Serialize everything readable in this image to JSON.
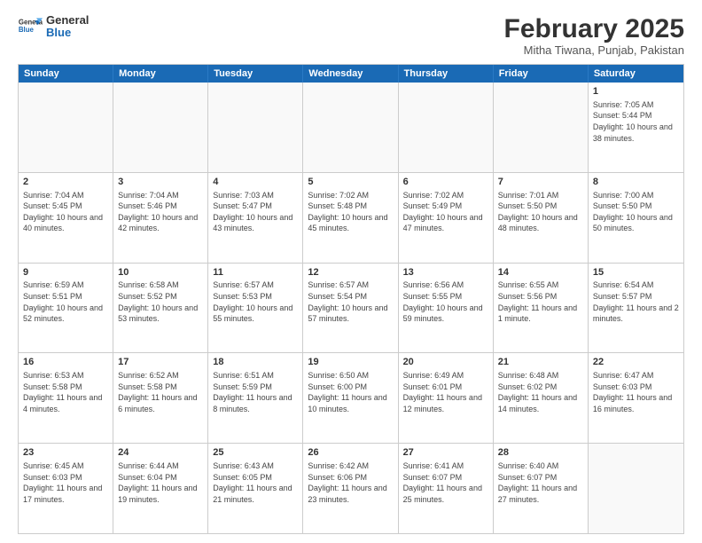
{
  "logo": {
    "line1": "General",
    "line2": "Blue"
  },
  "title": {
    "month_year": "February 2025",
    "location": "Mitha Tiwana, Punjab, Pakistan"
  },
  "header_days": [
    "Sunday",
    "Monday",
    "Tuesday",
    "Wednesday",
    "Thursday",
    "Friday",
    "Saturday"
  ],
  "weeks": [
    [
      {
        "day": "",
        "text": ""
      },
      {
        "day": "",
        "text": ""
      },
      {
        "day": "",
        "text": ""
      },
      {
        "day": "",
        "text": ""
      },
      {
        "day": "",
        "text": ""
      },
      {
        "day": "",
        "text": ""
      },
      {
        "day": "1",
        "text": "Sunrise: 7:05 AM\nSunset: 5:44 PM\nDaylight: 10 hours and 38 minutes."
      }
    ],
    [
      {
        "day": "2",
        "text": "Sunrise: 7:04 AM\nSunset: 5:45 PM\nDaylight: 10 hours and 40 minutes."
      },
      {
        "day": "3",
        "text": "Sunrise: 7:04 AM\nSunset: 5:46 PM\nDaylight: 10 hours and 42 minutes."
      },
      {
        "day": "4",
        "text": "Sunrise: 7:03 AM\nSunset: 5:47 PM\nDaylight: 10 hours and 43 minutes."
      },
      {
        "day": "5",
        "text": "Sunrise: 7:02 AM\nSunset: 5:48 PM\nDaylight: 10 hours and 45 minutes."
      },
      {
        "day": "6",
        "text": "Sunrise: 7:02 AM\nSunset: 5:49 PM\nDaylight: 10 hours and 47 minutes."
      },
      {
        "day": "7",
        "text": "Sunrise: 7:01 AM\nSunset: 5:50 PM\nDaylight: 10 hours and 48 minutes."
      },
      {
        "day": "8",
        "text": "Sunrise: 7:00 AM\nSunset: 5:50 PM\nDaylight: 10 hours and 50 minutes."
      }
    ],
    [
      {
        "day": "9",
        "text": "Sunrise: 6:59 AM\nSunset: 5:51 PM\nDaylight: 10 hours and 52 minutes."
      },
      {
        "day": "10",
        "text": "Sunrise: 6:58 AM\nSunset: 5:52 PM\nDaylight: 10 hours and 53 minutes."
      },
      {
        "day": "11",
        "text": "Sunrise: 6:57 AM\nSunset: 5:53 PM\nDaylight: 10 hours and 55 minutes."
      },
      {
        "day": "12",
        "text": "Sunrise: 6:57 AM\nSunset: 5:54 PM\nDaylight: 10 hours and 57 minutes."
      },
      {
        "day": "13",
        "text": "Sunrise: 6:56 AM\nSunset: 5:55 PM\nDaylight: 10 hours and 59 minutes."
      },
      {
        "day": "14",
        "text": "Sunrise: 6:55 AM\nSunset: 5:56 PM\nDaylight: 11 hours and 1 minute."
      },
      {
        "day": "15",
        "text": "Sunrise: 6:54 AM\nSunset: 5:57 PM\nDaylight: 11 hours and 2 minutes."
      }
    ],
    [
      {
        "day": "16",
        "text": "Sunrise: 6:53 AM\nSunset: 5:58 PM\nDaylight: 11 hours and 4 minutes."
      },
      {
        "day": "17",
        "text": "Sunrise: 6:52 AM\nSunset: 5:58 PM\nDaylight: 11 hours and 6 minutes."
      },
      {
        "day": "18",
        "text": "Sunrise: 6:51 AM\nSunset: 5:59 PM\nDaylight: 11 hours and 8 minutes."
      },
      {
        "day": "19",
        "text": "Sunrise: 6:50 AM\nSunset: 6:00 PM\nDaylight: 11 hours and 10 minutes."
      },
      {
        "day": "20",
        "text": "Sunrise: 6:49 AM\nSunset: 6:01 PM\nDaylight: 11 hours and 12 minutes."
      },
      {
        "day": "21",
        "text": "Sunrise: 6:48 AM\nSunset: 6:02 PM\nDaylight: 11 hours and 14 minutes."
      },
      {
        "day": "22",
        "text": "Sunrise: 6:47 AM\nSunset: 6:03 PM\nDaylight: 11 hours and 16 minutes."
      }
    ],
    [
      {
        "day": "23",
        "text": "Sunrise: 6:45 AM\nSunset: 6:03 PM\nDaylight: 11 hours and 17 minutes."
      },
      {
        "day": "24",
        "text": "Sunrise: 6:44 AM\nSunset: 6:04 PM\nDaylight: 11 hours and 19 minutes."
      },
      {
        "day": "25",
        "text": "Sunrise: 6:43 AM\nSunset: 6:05 PM\nDaylight: 11 hours and 21 minutes."
      },
      {
        "day": "26",
        "text": "Sunrise: 6:42 AM\nSunset: 6:06 PM\nDaylight: 11 hours and 23 minutes."
      },
      {
        "day": "27",
        "text": "Sunrise: 6:41 AM\nSunset: 6:07 PM\nDaylight: 11 hours and 25 minutes."
      },
      {
        "day": "28",
        "text": "Sunrise: 6:40 AM\nSunset: 6:07 PM\nDaylight: 11 hours and 27 minutes."
      },
      {
        "day": "",
        "text": ""
      }
    ]
  ]
}
